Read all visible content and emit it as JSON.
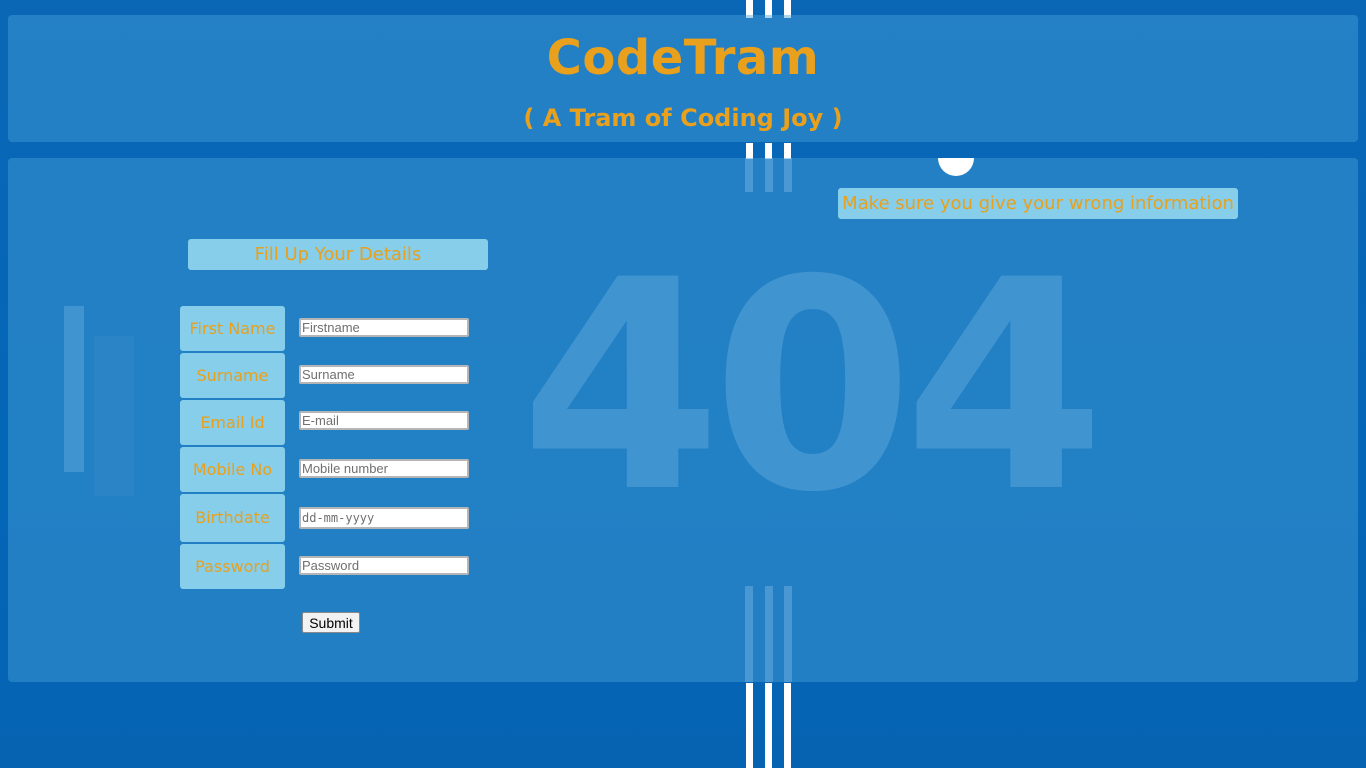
{
  "header": {
    "title": "CodeTram",
    "tagline": "( A Tram of Coding Joy )"
  },
  "background": {
    "error_code": "404"
  },
  "form": {
    "heading": "Fill Up Your Details",
    "warning": "Make sure you give your wrong information",
    "fields": [
      {
        "label": "First Name",
        "placeholder": "Firstname"
      },
      {
        "label": "Surname",
        "placeholder": "Surname"
      },
      {
        "label": "Email Id",
        "placeholder": "E-mail"
      },
      {
        "label": "Mobile No",
        "placeholder": "Mobile number"
      },
      {
        "label": "Birthdate",
        "placeholder": "dd-mm-yyyy"
      },
      {
        "label": "Password",
        "placeholder": "Password"
      }
    ],
    "submit_label": "Submit"
  },
  "colors": {
    "accent": "#e8a01d",
    "label_bg": "#87ceeb",
    "page_bg": "#0466b7"
  }
}
